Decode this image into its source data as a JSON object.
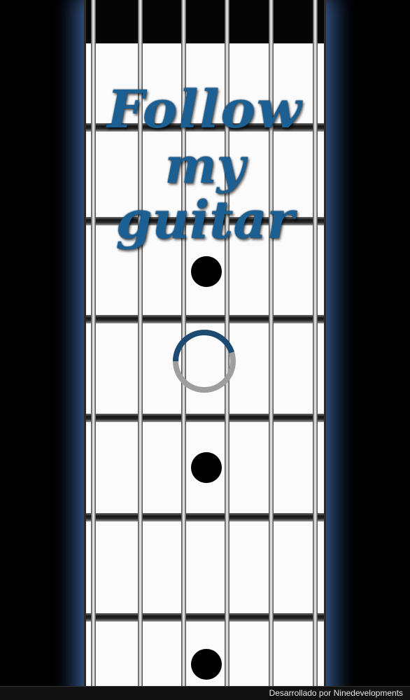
{
  "splash": {
    "title_lines": [
      "Follow",
      "my",
      "guitar"
    ],
    "title_color": "#1b5f93",
    "loading_progress": 0.45,
    "spinner_icon": "loading-spinner-icon",
    "footer_credit": "Desarrollado por Ninedevelopments"
  },
  "fretboard": {
    "string_count": 6,
    "inlay_markers": "dot",
    "glow_color": "#5a82be",
    "fret_color": "#151515"
  }
}
